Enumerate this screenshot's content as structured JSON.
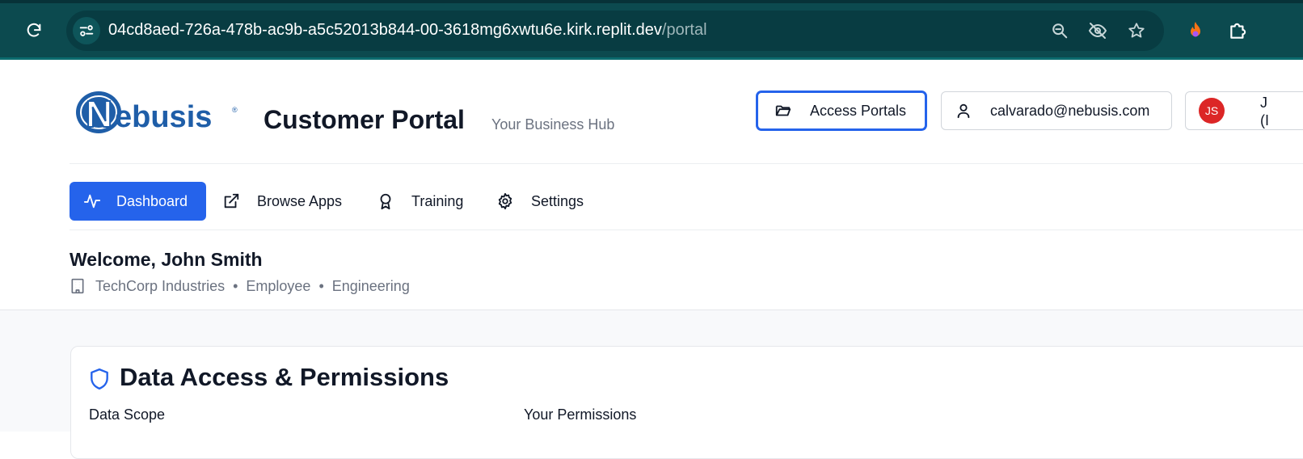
{
  "browser": {
    "url_host": "04cd8aed-726a-478b-ac9b-a5c52013b844-00-3618mg6xwtu6e.kirk.replit.dev",
    "url_path": "/portal",
    "icons": [
      "reload-icon",
      "site-info-icon",
      "zoom-out-icon",
      "eye-off-icon",
      "star-icon",
      "extension-flame-icon",
      "extensions-puzzle-icon"
    ]
  },
  "header": {
    "logo_text": "Nebusis",
    "title": "Customer Portal",
    "subtitle": "Your Business Hub",
    "access_portals_label": "Access Portals",
    "email": "calvarado@nebusis.com",
    "avatar_initials": "JS",
    "user_line1": "J",
    "user_line2": "(I"
  },
  "nav": {
    "items": [
      {
        "label": "Dashboard",
        "icon": "activity-icon",
        "active": true
      },
      {
        "label": "Browse Apps",
        "icon": "external-link-icon",
        "active": false
      },
      {
        "label": "Training",
        "icon": "award-icon",
        "active": false
      },
      {
        "label": "Settings",
        "icon": "gear-icon",
        "active": false
      }
    ]
  },
  "welcome": {
    "heading": "Welcome, John Smith",
    "company": "TechCorp Industries",
    "role": "Employee",
    "department": "Engineering",
    "separator": "•"
  },
  "card": {
    "title": "Data Access & Permissions",
    "data_scope_label": "Data Scope",
    "permissions_label": "Your Permissions"
  },
  "colors": {
    "browser_bar": "#0c4a4f",
    "accent": "#2563eb",
    "avatar": "#dc2626",
    "text": "#111827",
    "muted": "#6b7280"
  }
}
